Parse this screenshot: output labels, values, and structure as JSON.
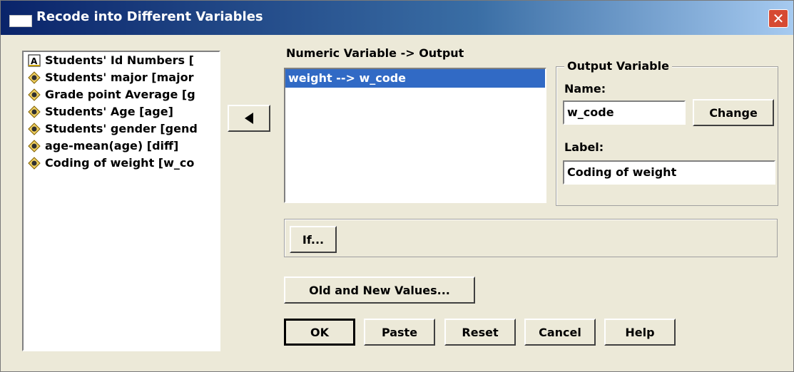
{
  "window": {
    "title": "Recode into Different Variables"
  },
  "source_list": {
    "items": [
      {
        "label": "Students' Id Numbers [",
        "icon": "string-variable-icon"
      },
      {
        "label": "Students' major [major",
        "icon": "numeric-variable-icon"
      },
      {
        "label": "Grade point Average [g",
        "icon": "numeric-variable-icon"
      },
      {
        "label": "Students' Age [age]",
        "icon": "numeric-variable-icon"
      },
      {
        "label": "Students' gender [gend",
        "icon": "numeric-variable-icon"
      },
      {
        "label": "age-mean(age) [diff]",
        "icon": "numeric-variable-icon"
      },
      {
        "label": "Coding of weight [w_co",
        "icon": "numeric-variable-icon"
      }
    ]
  },
  "mapping": {
    "header": "Numeric Variable -> Output",
    "items": [
      "weight --> w_code"
    ]
  },
  "output_variable": {
    "group_title": "Output Variable",
    "name_label": "Name:",
    "name_value": "w_code",
    "change_label": "Change",
    "label_label": "Label:",
    "label_value": "Coding of weight"
  },
  "buttons": {
    "if": "If...",
    "old_new": "Old and New Values...",
    "ok": "OK",
    "paste": "Paste",
    "reset": "Reset",
    "cancel": "Cancel",
    "help": "Help"
  },
  "colors": {
    "titlebar": "#0a246a",
    "selection": "#316ac5",
    "close": "#d64a32",
    "dialog": "#ece9d8"
  }
}
